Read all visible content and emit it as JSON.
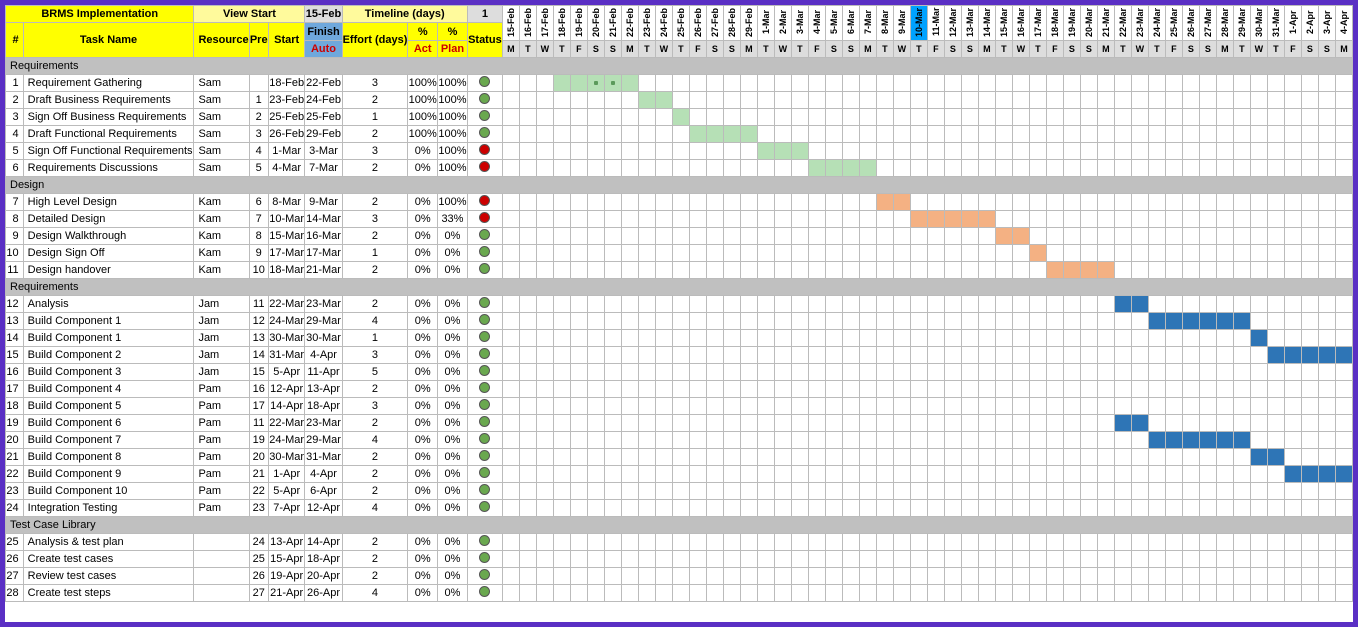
{
  "header": {
    "title": "BRMS Implementation",
    "viewStart": "View Start",
    "viewStartDate": "15-Feb",
    "timeline": "Timeline (days)",
    "timelineVal": "1",
    "idCol": "#",
    "taskName": "Task Name",
    "resource": "Resource",
    "pre": "Pre",
    "start": "Start",
    "finish": "Finish",
    "auto": "Auto",
    "effort": "Effort (days)",
    "pctAct": "%",
    "act": "Act",
    "pctPlan": "%",
    "plan": "Plan",
    "status": "Status"
  },
  "dates": [
    "15-Feb",
    "16-Feb",
    "17-Feb",
    "18-Feb",
    "19-Feb",
    "20-Feb",
    "21-Feb",
    "22-Feb",
    "23-Feb",
    "24-Feb",
    "25-Feb",
    "26-Feb",
    "27-Feb",
    "28-Feb",
    "29-Feb",
    "1-Mar",
    "2-Mar",
    "3-Mar",
    "4-Mar",
    "5-Mar",
    "6-Mar",
    "7-Mar",
    "8-Mar",
    "9-Mar",
    "10-Mar",
    "11-Mar",
    "12-Mar",
    "13-Mar",
    "14-Mar",
    "15-Mar",
    "16-Mar",
    "17-Mar",
    "18-Mar",
    "19-Mar",
    "20-Mar",
    "21-Mar",
    "22-Mar",
    "23-Mar",
    "24-Mar",
    "25-Mar",
    "26-Mar",
    "27-Mar",
    "28-Mar",
    "29-Mar",
    "30-Mar",
    "31-Mar",
    "1-Apr",
    "2-Apr",
    "3-Apr",
    "4-Apr"
  ],
  "dow": [
    "M",
    "T",
    "W",
    "T",
    "F",
    "S",
    "S",
    "M",
    "T",
    "W",
    "T",
    "F",
    "S",
    "S",
    "M",
    "T",
    "W",
    "T",
    "F",
    "S",
    "S",
    "M",
    "T",
    "W",
    "T",
    "F",
    "S",
    "S",
    "M",
    "T",
    "W",
    "T",
    "F",
    "S",
    "S",
    "M",
    "T",
    "W",
    "T",
    "F",
    "S",
    "S",
    "M",
    "T",
    "W",
    "T",
    "F",
    "S",
    "S",
    "M"
  ],
  "todayIndex": 24,
  "groups": [
    {
      "name": "Requirements",
      "rows": [
        {
          "id": 1,
          "task": "Requirement Gathering",
          "res": "Sam",
          "pre": "",
          "start": "18-Feb",
          "finish": "22-Feb",
          "eff": 3,
          "act": "100%",
          "plan": "100%",
          "status": "g",
          "bar": {
            "from": 3,
            "to": 7,
            "style": "gdot"
          }
        },
        {
          "id": 2,
          "task": "Draft Business Requirements",
          "res": "Sam",
          "pre": 1,
          "start": "23-Feb",
          "finish": "24-Feb",
          "eff": 2,
          "act": "100%",
          "plan": "100%",
          "status": "g",
          "bar": {
            "from": 8,
            "to": 9,
            "style": "g"
          }
        },
        {
          "id": 3,
          "task": "Sign Off Business Requirements",
          "res": "Sam",
          "pre": 2,
          "start": "25-Feb",
          "finish": "25-Feb",
          "eff": 1,
          "act": "100%",
          "plan": "100%",
          "status": "g",
          "bar": {
            "from": 10,
            "to": 10,
            "style": "g"
          }
        },
        {
          "id": 4,
          "task": "Draft Functional Requirements",
          "res": "Sam",
          "pre": 3,
          "start": "26-Feb",
          "finish": "29-Feb",
          "eff": 2,
          "act": "100%",
          "plan": "100%",
          "status": "g",
          "bar": {
            "from": 11,
            "to": 14,
            "style": "g"
          }
        },
        {
          "id": 5,
          "task": "Sign Off Functional Requirements",
          "res": "Sam",
          "pre": 4,
          "start": "1-Mar",
          "finish": "3-Mar",
          "eff": 3,
          "act": "0%",
          "plan": "100%",
          "status": "r",
          "bar": {
            "from": 15,
            "to": 17,
            "style": "gdot"
          }
        },
        {
          "id": 6,
          "task": "Requirements Discussions",
          "res": "Sam",
          "pre": 5,
          "start": "4-Mar",
          "finish": "7-Mar",
          "eff": 2,
          "act": "0%",
          "plan": "100%",
          "status": "r",
          "bar": {
            "from": 18,
            "to": 21,
            "style": "g"
          }
        }
      ]
    },
    {
      "name": "Design",
      "rows": [
        {
          "id": 7,
          "task": "High Level Design",
          "res": "Kam",
          "pre": 6,
          "start": "8-Mar",
          "finish": "9-Mar",
          "eff": 2,
          "act": "0%",
          "plan": "100%",
          "status": "r",
          "bar": {
            "from": 22,
            "to": 23,
            "style": "o"
          }
        },
        {
          "id": 8,
          "task": "Detailed Design",
          "res": "Kam",
          "pre": 7,
          "start": "10-Mar",
          "finish": "14-Mar",
          "eff": 3,
          "act": "0%",
          "plan": "33%",
          "status": "r",
          "bar": {
            "from": 24,
            "to": 28,
            "style": "o"
          }
        },
        {
          "id": 9,
          "task": "Design Walkthrough",
          "res": "Kam",
          "pre": 8,
          "start": "15-Mar",
          "finish": "16-Mar",
          "eff": 2,
          "act": "0%",
          "plan": "0%",
          "status": "g",
          "bar": {
            "from": 29,
            "to": 30,
            "style": "o"
          }
        },
        {
          "id": 10,
          "task": "Design Sign Off",
          "res": "Kam",
          "pre": 9,
          "start": "17-Mar",
          "finish": "17-Mar",
          "eff": 1,
          "act": "0%",
          "plan": "0%",
          "status": "g",
          "bar": {
            "from": 31,
            "to": 31,
            "style": "o"
          }
        },
        {
          "id": 11,
          "task": "Design handover",
          "res": "Kam",
          "pre": 10,
          "start": "18-Mar",
          "finish": "21-Mar",
          "eff": 2,
          "act": "0%",
          "plan": "0%",
          "status": "g",
          "bar": {
            "from": 32,
            "to": 35,
            "style": "o"
          }
        }
      ]
    },
    {
      "name": "Requirements",
      "rows": [
        {
          "id": 12,
          "task": "Analysis",
          "res": "Jam",
          "pre": 11,
          "start": "22-Mar",
          "finish": "23-Mar",
          "eff": 2,
          "act": "0%",
          "plan": "0%",
          "status": "g",
          "bar": {
            "from": 36,
            "to": 37,
            "style": "b"
          }
        },
        {
          "id": 13,
          "task": "Build Component 1",
          "res": "Jam",
          "pre": 12,
          "start": "24-Mar",
          "finish": "29-Mar",
          "eff": 4,
          "act": "0%",
          "plan": "0%",
          "status": "g",
          "bar": {
            "from": 38,
            "to": 43,
            "style": "b"
          }
        },
        {
          "id": 14,
          "task": "Build Component 1",
          "res": "Jam",
          "pre": 13,
          "start": "30-Mar",
          "finish": "30-Mar",
          "eff": 1,
          "act": "0%",
          "plan": "0%",
          "status": "g",
          "bar": {
            "from": 44,
            "to": 44,
            "style": "b"
          }
        },
        {
          "id": 15,
          "task": "Build Component 2",
          "res": "Jam",
          "pre": 14,
          "start": "31-Mar",
          "finish": "4-Apr",
          "eff": 3,
          "act": "0%",
          "plan": "0%",
          "status": "g",
          "bar": {
            "from": 45,
            "to": 49,
            "style": "b"
          }
        },
        {
          "id": 16,
          "task": "Build Component 3",
          "res": "Jam",
          "pre": 15,
          "start": "5-Apr",
          "finish": "11-Apr",
          "eff": 5,
          "act": "0%",
          "plan": "0%",
          "status": "g",
          "bar": {
            "from": 50,
            "to": 50,
            "style": "b"
          }
        },
        {
          "id": 17,
          "task": "Build Component 4",
          "res": "Pam",
          "pre": 16,
          "start": "12-Apr",
          "finish": "13-Apr",
          "eff": 2,
          "act": "0%",
          "plan": "0%",
          "status": "g",
          "bar": null
        },
        {
          "id": 18,
          "task": "Build Component 5",
          "res": "Pam",
          "pre": 17,
          "start": "14-Apr",
          "finish": "18-Apr",
          "eff": 3,
          "act": "0%",
          "plan": "0%",
          "status": "g",
          "bar": null
        },
        {
          "id": 19,
          "task": "Build Component 6",
          "res": "Pam",
          "pre": 11,
          "start": "22-Mar",
          "finish": "23-Mar",
          "eff": 2,
          "act": "0%",
          "plan": "0%",
          "status": "g",
          "bar": {
            "from": 36,
            "to": 37,
            "style": "b"
          }
        },
        {
          "id": 20,
          "task": "Build Component 7",
          "res": "Pam",
          "pre": 19,
          "start": "24-Mar",
          "finish": "29-Mar",
          "eff": 4,
          "act": "0%",
          "plan": "0%",
          "status": "g",
          "bar": {
            "from": 38,
            "to": 43,
            "style": "b"
          }
        },
        {
          "id": 21,
          "task": "Build Component 8",
          "res": "Pam",
          "pre": 20,
          "start": "30-Mar",
          "finish": "31-Mar",
          "eff": 2,
          "act": "0%",
          "plan": "0%",
          "status": "g",
          "bar": {
            "from": 44,
            "to": 45,
            "style": "b"
          }
        },
        {
          "id": 22,
          "task": "Build Component 9",
          "res": "Pam",
          "pre": 21,
          "start": "1-Apr",
          "finish": "4-Apr",
          "eff": 2,
          "act": "0%",
          "plan": "0%",
          "status": "g",
          "bar": {
            "from": 46,
            "to": 49,
            "style": "b"
          }
        },
        {
          "id": 23,
          "task": "Build Component 10",
          "res": "Pam",
          "pre": 22,
          "start": "5-Apr",
          "finish": "6-Apr",
          "eff": 2,
          "act": "0%",
          "plan": "0%",
          "status": "g",
          "bar": {
            "from": 50,
            "to": 50,
            "style": "b"
          }
        },
        {
          "id": 24,
          "task": "Integration Testing",
          "res": "Pam",
          "pre": 23,
          "start": "7-Apr",
          "finish": "12-Apr",
          "eff": 4,
          "act": "0%",
          "plan": "0%",
          "status": "g",
          "bar": null
        }
      ]
    },
    {
      "name": "Test Case Library",
      "rows": [
        {
          "id": 25,
          "task": "Analysis & test plan",
          "res": "",
          "pre": 24,
          "start": "13-Apr",
          "finish": "14-Apr",
          "eff": 2,
          "act": "0%",
          "plan": "0%",
          "status": "g",
          "bar": null
        },
        {
          "id": 26,
          "task": "Create test cases",
          "res": "",
          "pre": 25,
          "start": "15-Apr",
          "finish": "18-Apr",
          "eff": 2,
          "act": "0%",
          "plan": "0%",
          "status": "g",
          "bar": null
        },
        {
          "id": 27,
          "task": "Review test cases",
          "res": "",
          "pre": 26,
          "start": "19-Apr",
          "finish": "20-Apr",
          "eff": 2,
          "act": "0%",
          "plan": "0%",
          "status": "g",
          "bar": null
        },
        {
          "id": 28,
          "task": "Create test steps",
          "res": "",
          "pre": 27,
          "start": "21-Apr",
          "finish": "26-Apr",
          "eff": 4,
          "act": "0%",
          "plan": "0%",
          "status": "g",
          "bar": null
        }
      ]
    }
  ]
}
